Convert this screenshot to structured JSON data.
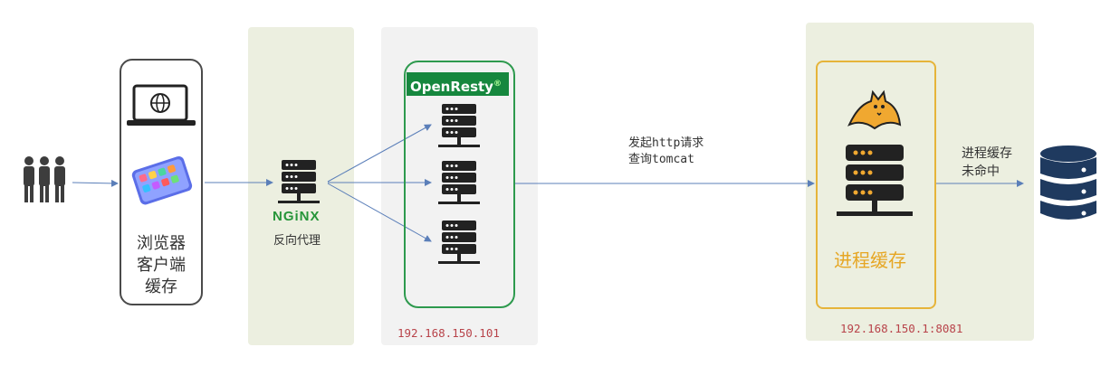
{
  "browser": {
    "label_lines": [
      "浏览器",
      "客户端",
      "缓存"
    ]
  },
  "nginx": {
    "logo_text": "NGiNX",
    "label": "反向代理"
  },
  "openresty": {
    "logo_text": "OpenResty",
    "logo_mark": "®",
    "ip": "192.168.150.101"
  },
  "request": {
    "line1": "发起http请求",
    "line2": "查询tomcat"
  },
  "tomcat": {
    "process_cache_label": "进程缓存",
    "ip": "192.168.150.1:8081"
  },
  "cache_miss": {
    "line1": "进程缓存",
    "line2": "未命中"
  },
  "colors": {
    "arrow": "#5b7fb9",
    "openresty_green": "#2e9a4e",
    "tomcat_gold": "#e6b43a",
    "ip_red": "#b8434a",
    "db_navy": "#1f3a5f"
  },
  "icons": [
    "users-icon",
    "laptop-globe-icon",
    "phone-apps-icon",
    "server-icon",
    "tomcat-cat-icon",
    "database-icon"
  ]
}
